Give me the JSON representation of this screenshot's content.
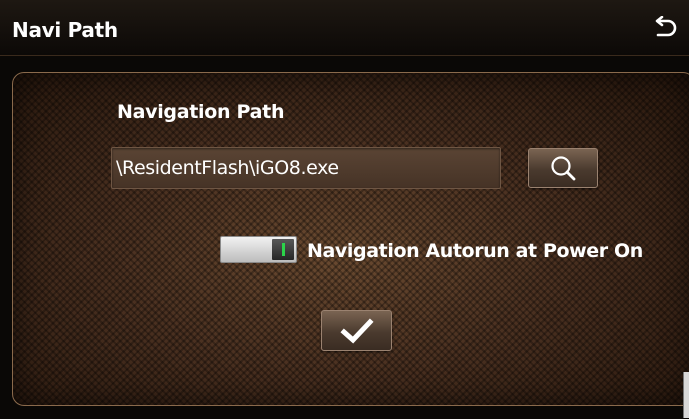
{
  "header": {
    "title": "Navi Path",
    "back_icon": "back-arrow-icon"
  },
  "navigation": {
    "section_label": "Navigation Path",
    "path_value": "\\ResidentFlash\\iGO8.exe",
    "search_icon": "search-icon"
  },
  "autorun": {
    "label": "Navigation Autorun at Power On",
    "enabled": true,
    "indicator_color": "#2bd34a"
  },
  "confirm": {
    "icon": "checkmark-icon"
  },
  "colors": {
    "title_bar": "#120e0a",
    "panel_border": "#8a6a4c",
    "text": "#ffffff"
  }
}
